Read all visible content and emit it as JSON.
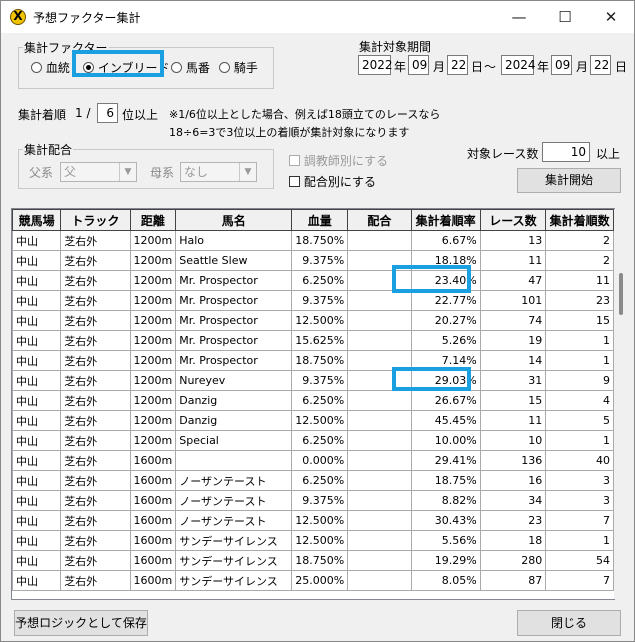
{
  "window": {
    "title": "予想ファクター集計",
    "icon_letter": "X",
    "minimize": "—",
    "maximize": "☐",
    "close": "✕"
  },
  "factor_group": {
    "legend": "集計ファクター",
    "options": [
      "血統",
      "インブリード",
      "馬番",
      "騎手"
    ],
    "selected": 1
  },
  "period": {
    "label": "集計対象期間",
    "from_year": "2022",
    "from_month": "09",
    "from_day": "22",
    "to_year": "2024",
    "to_month": "09",
    "to_day": "22",
    "year_unit": "年",
    "month_unit": "月",
    "day_unit": "日",
    "tilde": "～"
  },
  "rank": {
    "label": "集計着順",
    "prefix": "1 /",
    "value": "6",
    "suffix": "位以上",
    "note1": "※1/6位以上とした場合、例えば18頭立てのレースなら",
    "note2": "18÷6=3で3位以上の着順が集計対象になります"
  },
  "mating": {
    "legend": "集計配合",
    "sire_label": "父系",
    "sire_value": "父",
    "dam_label": "母系",
    "dam_value": "なし"
  },
  "options": {
    "by_trainer": "調教師別にする",
    "by_mating": "配合別にする"
  },
  "races": {
    "label": "対象レース数",
    "value": "10",
    "suffix": "以上"
  },
  "start_button": "集計開始",
  "save_button": "予想ロジックとして保存",
  "close_button": "閉じる",
  "columns": [
    "競馬場",
    "トラック",
    "距離",
    "馬名",
    "血量",
    "配合",
    "集計着順率",
    "レース数",
    "集計着順数"
  ],
  "rows": [
    [
      "中山",
      "芝右外",
      "1200m",
      "Halo",
      "18.750%",
      "",
      "6.67%",
      "13",
      "2"
    ],
    [
      "中山",
      "芝右外",
      "1200m",
      "Seattle Slew",
      "9.375%",
      "",
      "18.18%",
      "11",
      "2"
    ],
    [
      "中山",
      "芝右外",
      "1200m",
      "Mr. Prospector",
      "6.250%",
      "",
      "23.40%",
      "47",
      "11"
    ],
    [
      "中山",
      "芝右外",
      "1200m",
      "Mr. Prospector",
      "9.375%",
      "",
      "22.77%",
      "101",
      "23"
    ],
    [
      "中山",
      "芝右外",
      "1200m",
      "Mr. Prospector",
      "12.500%",
      "",
      "20.27%",
      "74",
      "15"
    ],
    [
      "中山",
      "芝右外",
      "1200m",
      "Mr. Prospector",
      "15.625%",
      "",
      "5.26%",
      "19",
      "1"
    ],
    [
      "中山",
      "芝右外",
      "1200m",
      "Mr. Prospector",
      "18.750%",
      "",
      "7.14%",
      "14",
      "1"
    ],
    [
      "中山",
      "芝右外",
      "1200m",
      "Nureyev",
      "9.375%",
      "",
      "29.03%",
      "31",
      "9"
    ],
    [
      "中山",
      "芝右外",
      "1200m",
      "Danzig",
      "6.250%",
      "",
      "26.67%",
      "15",
      "4"
    ],
    [
      "中山",
      "芝右外",
      "1200m",
      "Danzig",
      "12.500%",
      "",
      "45.45%",
      "11",
      "5"
    ],
    [
      "中山",
      "芝右外",
      "1200m",
      "Special",
      "6.250%",
      "",
      "10.00%",
      "10",
      "1"
    ],
    [
      "中山",
      "芝右外",
      "1600m",
      "",
      "0.000%",
      "",
      "29.41%",
      "136",
      "40"
    ],
    [
      "中山",
      "芝右外",
      "1600m",
      "ノーザンテースト",
      "6.250%",
      "",
      "18.75%",
      "16",
      "3"
    ],
    [
      "中山",
      "芝右外",
      "1600m",
      "ノーザンテースト",
      "9.375%",
      "",
      "8.82%",
      "34",
      "3"
    ],
    [
      "中山",
      "芝右外",
      "1600m",
      "ノーザンテースト",
      "12.500%",
      "",
      "30.43%",
      "23",
      "7"
    ],
    [
      "中山",
      "芝右外",
      "1600m",
      "サンデーサイレンス",
      "12.500%",
      "",
      "5.56%",
      "18",
      "1"
    ],
    [
      "中山",
      "芝右外",
      "1600m",
      "サンデーサイレンス",
      "18.750%",
      "",
      "19.29%",
      "280",
      "54"
    ],
    [
      "中山",
      "芝右外",
      "1600m",
      "サンデーサイレンス",
      "25.000%",
      "",
      "8.05%",
      "87",
      "7"
    ]
  ]
}
